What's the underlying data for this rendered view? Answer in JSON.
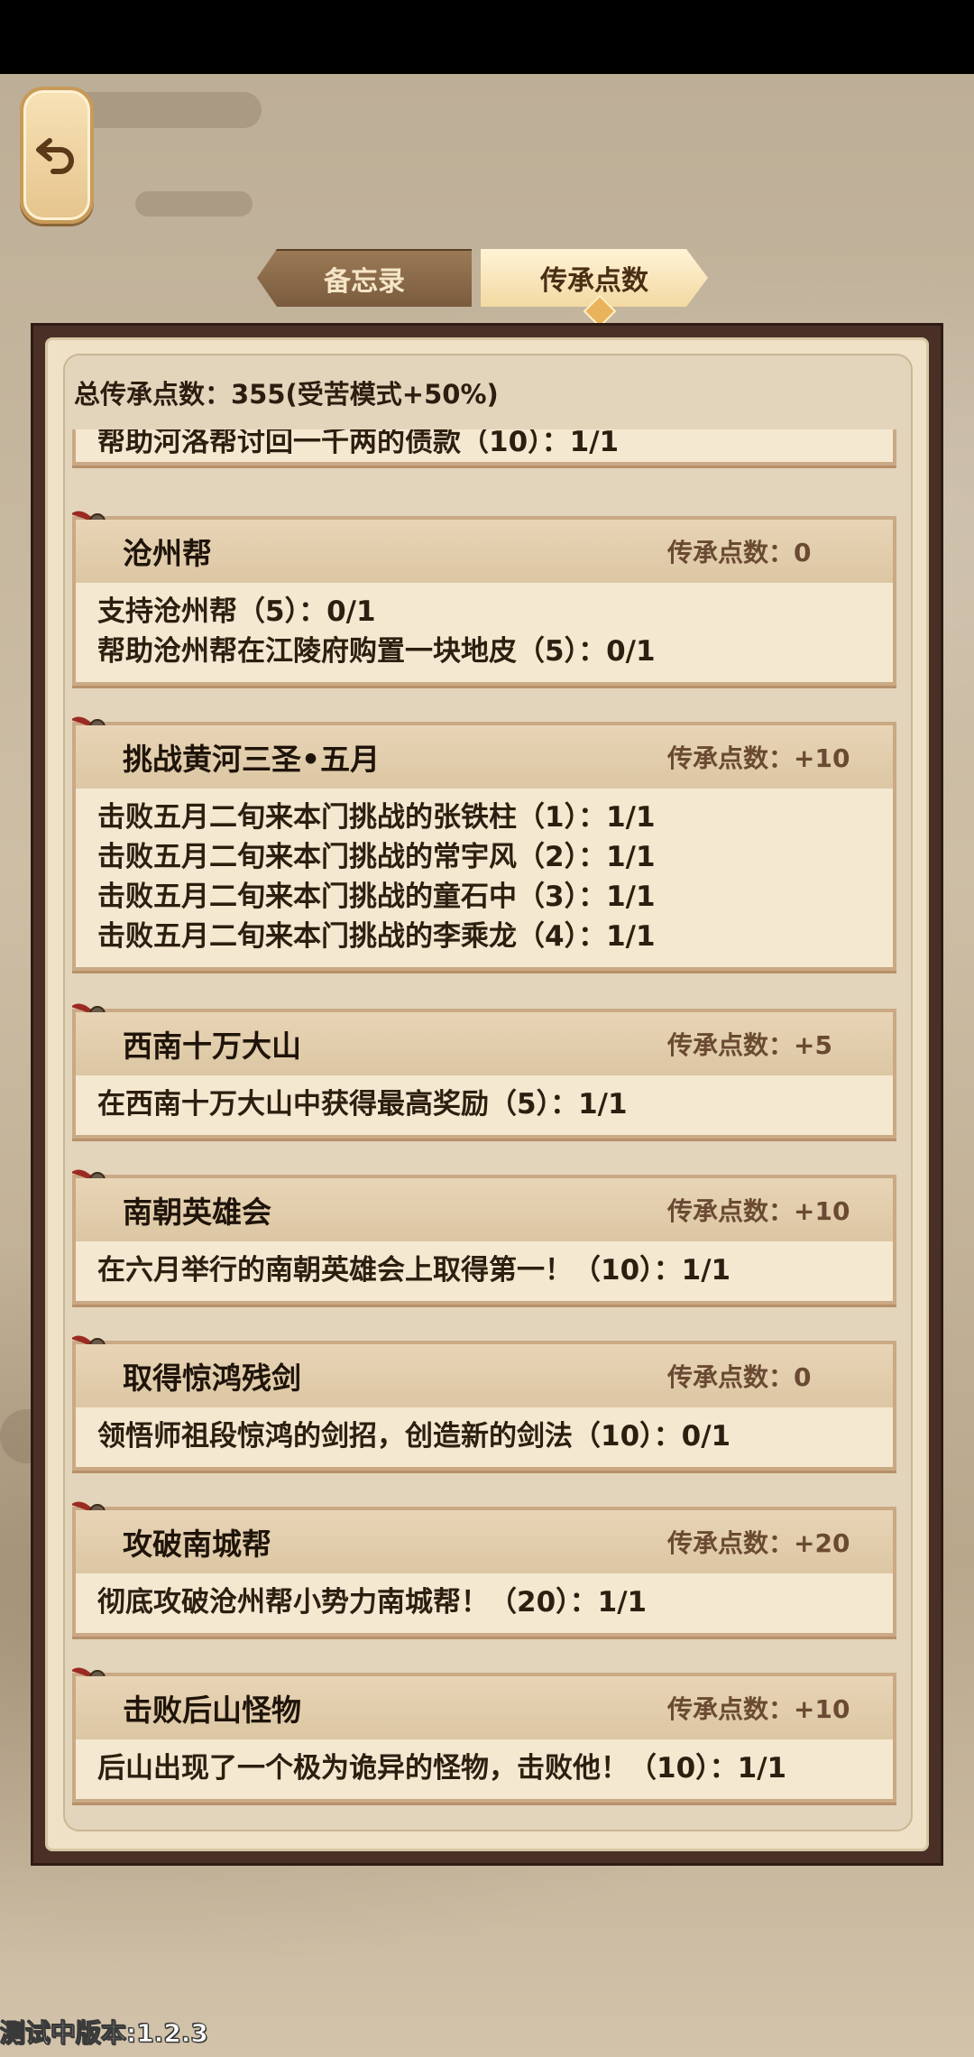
{
  "tabs": {
    "memo": "备忘录",
    "points": "传承点数"
  },
  "total_label": "总传承点数：355(受苦模式+50%)",
  "partial_card": {
    "lines": [
      "帮助河洛帮讨回一千两的债款（10）：1/1"
    ]
  },
  "cards": [
    {
      "title": "沧州帮",
      "points": "传承点数：0",
      "lines": [
        "支持沧州帮（5）：0/1",
        "帮助沧州帮在江陵府购置一块地皮（5）：0/1"
      ]
    },
    {
      "title": "挑战黄河三圣•五月",
      "points": "传承点数：+10",
      "lines": [
        "击败五月二旬来本门挑战的张铁柱（1）：1/1",
        "击败五月二旬来本门挑战的常宇风（2）：1/1",
        "击败五月二旬来本门挑战的童石中（3）：1/1",
        "击败五月二旬来本门挑战的李乘龙（4）：1/1"
      ]
    },
    {
      "title": "西南十万大山",
      "points": "传承点数：+5",
      "lines": [
        "在西南十万大山中获得最高奖励（5）：1/1"
      ]
    },
    {
      "title": "南朝英雄会",
      "points": "传承点数：+10",
      "lines": [
        "在六月举行的南朝英雄会上取得第一！（10）：1/1"
      ]
    },
    {
      "title": "取得惊鸿残剑",
      "points": "传承点数：0",
      "lines": [
        "领悟师祖段惊鸿的剑招，创造新的剑法（10）：0/1"
      ]
    },
    {
      "title": "攻破南城帮",
      "points": "传承点数：+20",
      "lines": [
        "彻底攻破沧州帮小势力南城帮！（20）：1/1"
      ]
    },
    {
      "title": "击败后山怪物",
      "points": "传承点数：+10",
      "lines": [
        "后山出现了一个极为诡异的怪物，击败他！（10）：1/1"
      ]
    }
  ],
  "version": "测试中版本:1.2.3",
  "icons": {
    "back": "back-arrow-icon",
    "pin": "ribbon-pin-icon"
  }
}
